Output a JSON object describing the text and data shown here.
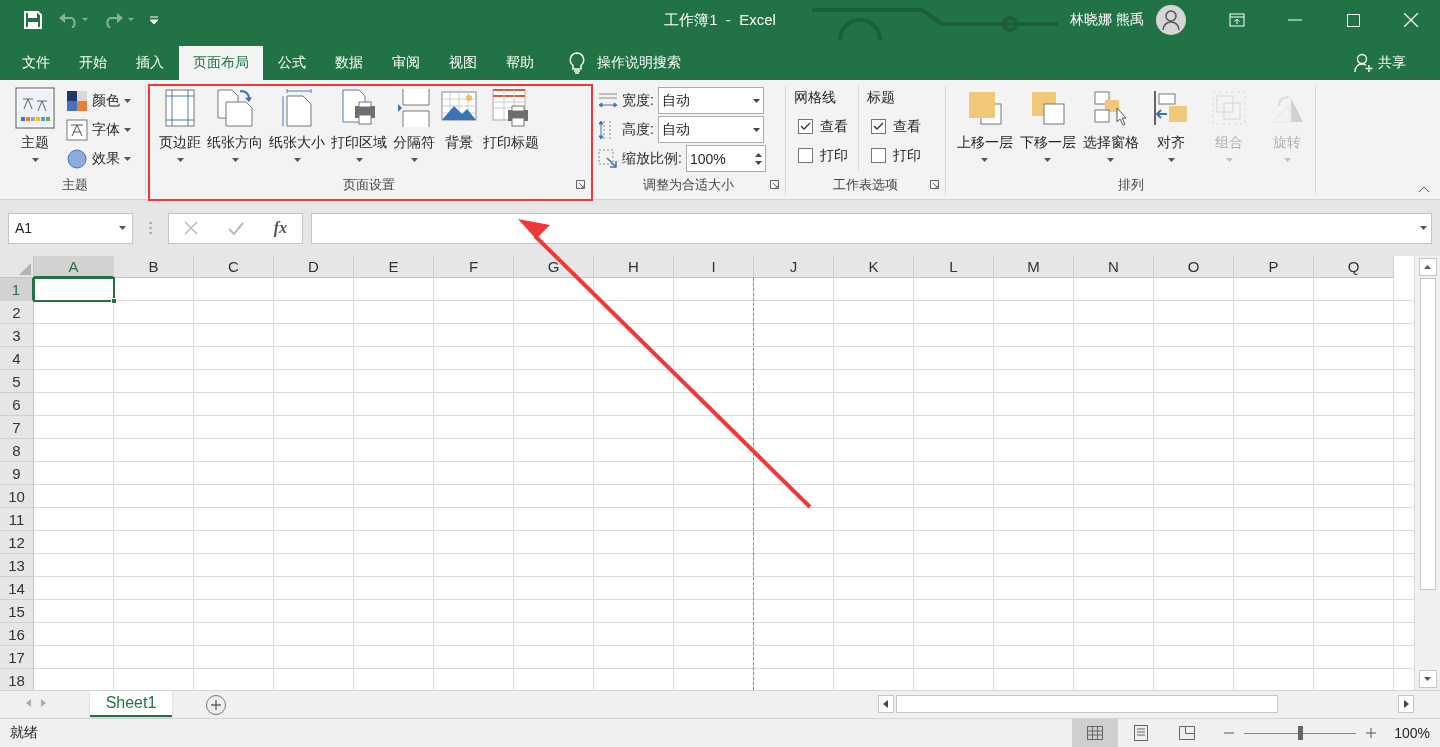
{
  "title_bar": {
    "title": "工作簿1  -  Excel",
    "user": "林晓娜 熊禹"
  },
  "tabs": [
    {
      "label": "文件",
      "selected": false
    },
    {
      "label": "开始",
      "selected": false
    },
    {
      "label": "插入",
      "selected": false
    },
    {
      "label": "页面布局",
      "selected": true
    },
    {
      "label": "公式",
      "selected": false
    },
    {
      "label": "数据",
      "selected": false
    },
    {
      "label": "审阅",
      "selected": false
    },
    {
      "label": "视图",
      "selected": false
    },
    {
      "label": "帮助",
      "selected": false
    }
  ],
  "tell_me": {
    "placeholder": "操作说明搜索"
  },
  "share": "共享",
  "ribbon": {
    "theme_group": {
      "label": "主题",
      "main": "主题",
      "options": [
        "颜色",
        "字体",
        "效果"
      ]
    },
    "page_setup": {
      "label": "页面设置",
      "buttons": [
        {
          "label": "页边距",
          "dropdown": true
        },
        {
          "label": "纸张方向",
          "dropdown": true
        },
        {
          "label": "纸张大小",
          "dropdown": true
        },
        {
          "label": "打印区域",
          "dropdown": true
        },
        {
          "label": "分隔符",
          "dropdown": true
        },
        {
          "label": "背景",
          "dropdown": false
        },
        {
          "label": "打印标题",
          "dropdown": false
        }
      ]
    },
    "scale_to_fit": {
      "label": "调整为合适大小",
      "fields": [
        {
          "kind": "dropdown",
          "label": "宽度:",
          "value": "自动"
        },
        {
          "kind": "dropdown",
          "label": "高度:",
          "value": "自动"
        },
        {
          "kind": "spin",
          "label": "缩放比例:",
          "value": "100%"
        }
      ]
    },
    "sheet_options": {
      "label": "工作表选项",
      "columns": [
        {
          "heading": "网格线",
          "options": [
            {
              "label": "查看",
              "checked": true
            },
            {
              "label": "打印",
              "checked": false
            }
          ]
        },
        {
          "heading": "标题",
          "options": [
            {
              "label": "查看",
              "checked": true
            },
            {
              "label": "打印",
              "checked": false
            }
          ]
        }
      ]
    },
    "arrange": {
      "label": "排列",
      "buttons": [
        {
          "label": "上移一层",
          "disabled": false
        },
        {
          "label": "下移一层",
          "disabled": false
        },
        {
          "label": "选择窗格",
          "disabled": false
        },
        {
          "label": "对齐",
          "disabled": false
        },
        {
          "label": "组合",
          "disabled": true
        },
        {
          "label": "旋转",
          "disabled": true
        }
      ]
    }
  },
  "formula_bar": {
    "name_box": "A1",
    "fx": "fx"
  },
  "sheet": {
    "columns": [
      {
        "label": "A",
        "selected": true,
        "page_break": false
      },
      {
        "label": "B",
        "selected": false,
        "page_break": false
      },
      {
        "label": "C",
        "selected": false,
        "page_break": false
      },
      {
        "label": "D",
        "selected": false,
        "page_break": false
      },
      {
        "label": "E",
        "selected": false,
        "page_break": false
      },
      {
        "label": "F",
        "selected": false,
        "page_break": false
      },
      {
        "label": "G",
        "selected": false,
        "page_break": false
      },
      {
        "label": "H",
        "selected": false,
        "page_break": false
      },
      {
        "label": "I",
        "selected": false,
        "page_break": true
      },
      {
        "label": "J",
        "selected": false,
        "page_break": false
      },
      {
        "label": "K",
        "selected": false,
        "page_break": false
      },
      {
        "label": "L",
        "selected": false,
        "page_break": false
      },
      {
        "label": "M",
        "selected": false,
        "page_break": false
      },
      {
        "label": "N",
        "selected": false,
        "page_break": false
      },
      {
        "label": "O",
        "selected": false,
        "page_break": false
      },
      {
        "label": "P",
        "selected": false,
        "page_break": false
      },
      {
        "label": "Q",
        "selected": false,
        "page_break": false
      }
    ],
    "rows": [
      {
        "label": "1",
        "selected": true
      },
      {
        "label": "2",
        "selected": false
      },
      {
        "label": "3",
        "selected": false
      },
      {
        "label": "4",
        "selected": false
      },
      {
        "label": "5",
        "selected": false
      },
      {
        "label": "6",
        "selected": false
      },
      {
        "label": "7",
        "selected": false
      },
      {
        "label": "8",
        "selected": false
      },
      {
        "label": "9",
        "selected": false
      },
      {
        "label": "10",
        "selected": false
      },
      {
        "label": "11",
        "selected": false
      },
      {
        "label": "12",
        "selected": false
      },
      {
        "label": "13",
        "selected": false
      },
      {
        "label": "14",
        "selected": false
      },
      {
        "label": "15",
        "selected": false
      },
      {
        "label": "16",
        "selected": false
      },
      {
        "label": "17",
        "selected": false
      },
      {
        "label": "18",
        "selected": false
      }
    ]
  },
  "sheet_tabs": [
    {
      "label": "Sheet1",
      "selected": true
    }
  ],
  "status_bar": {
    "status": "就绪",
    "views": [
      {
        "selected": true
      },
      {
        "selected": false
      },
      {
        "selected": false
      }
    ],
    "zoom": {
      "level": 0.5,
      "reading": "100%"
    }
  }
}
